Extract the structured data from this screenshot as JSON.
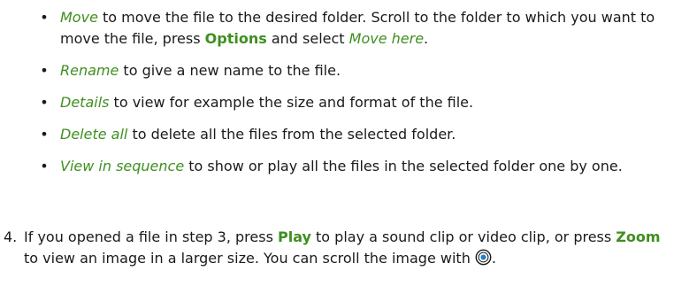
{
  "bullets": [
    {
      "term": "Move",
      "text_before": " to move the file to the desired folder. Scroll to the folder to which you want to move the file, press ",
      "key": "Options",
      "text_middle": " and select ",
      "term2": "Move here",
      "text_after": "."
    },
    {
      "term": "Rename",
      "text": " to give a new name to the file."
    },
    {
      "term": "Details",
      "text": " to view for example the size and format of the file."
    },
    {
      "term": "Delete all",
      "text": " to delete all the files from the selected folder."
    },
    {
      "term": "View in sequence",
      "text": " to show or play all the files in the selected folder one by one."
    }
  ],
  "bullet_symbol": "•",
  "step": {
    "number": "4.",
    "part1": "If you opened a file in step 3, press ",
    "key1": "Play",
    "part2": " to play a sound clip or video clip, or press ",
    "key2": "Zoom",
    "part3": " to view an image in a larger size. You can scroll the image with ",
    "icon": "scroll-key-icon",
    "part4": "."
  },
  "colors": {
    "accent": "#3f8f1f",
    "text": "#1a1a1a",
    "icon_blue": "#1e7fd0"
  }
}
